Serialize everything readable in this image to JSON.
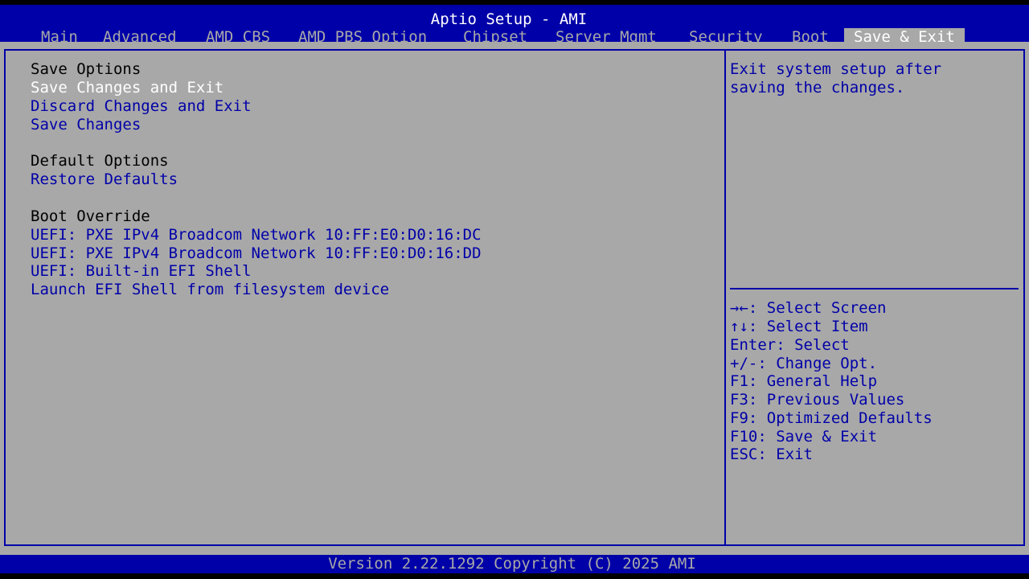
{
  "window": {
    "title": "Aptio Setup - AMI"
  },
  "tabs": [
    {
      "label": "Main"
    },
    {
      "label": "Advanced"
    },
    {
      "label": "AMD CBS"
    },
    {
      "label": "AMD PBS Option"
    },
    {
      "label": "Chipset"
    },
    {
      "label": "Server Mgmt"
    },
    {
      "label": "Security"
    },
    {
      "label": "Boot"
    },
    {
      "label": "Save & Exit",
      "active": true
    }
  ],
  "menu": {
    "save_options": {
      "heading": "Save Options",
      "items": [
        {
          "label": "Save Changes and Exit",
          "selected": true
        },
        {
          "label": "Discard Changes and Exit"
        },
        {
          "label": "Save Changes"
        }
      ]
    },
    "default_options": {
      "heading": "Default Options",
      "items": [
        {
          "label": "Restore Defaults"
        }
      ]
    },
    "boot_override": {
      "heading": "Boot Override",
      "items": [
        {
          "label": "UEFI: PXE IPv4 Broadcom Network 10:FF:E0:D0:16:DC"
        },
        {
          "label": "UEFI: PXE IPv4 Broadcom Network 10:FF:E0:D0:16:DD"
        },
        {
          "label": "UEFI: Built-in EFI Shell"
        },
        {
          "label": "Launch EFI Shell from filesystem device"
        }
      ]
    }
  },
  "help": {
    "description": [
      "Exit system setup after",
      "saving the changes."
    ],
    "keys": [
      "→←: Select Screen",
      "↑↓: Select Item",
      "Enter: Select",
      "+/-: Change Opt.",
      "F1: General Help",
      "F3: Previous Values",
      "F9: Optimized Defaults",
      "F10: Save & Exit",
      "ESC: Exit"
    ]
  },
  "footer": {
    "text": "Version 2.22.1292 Copyright (C) 2025 AMI"
  },
  "colors": {
    "background_panel": "#a8a8a8",
    "bar_blue": "#0000a8",
    "text_white": "#ffffff",
    "text_black": "#000000"
  }
}
